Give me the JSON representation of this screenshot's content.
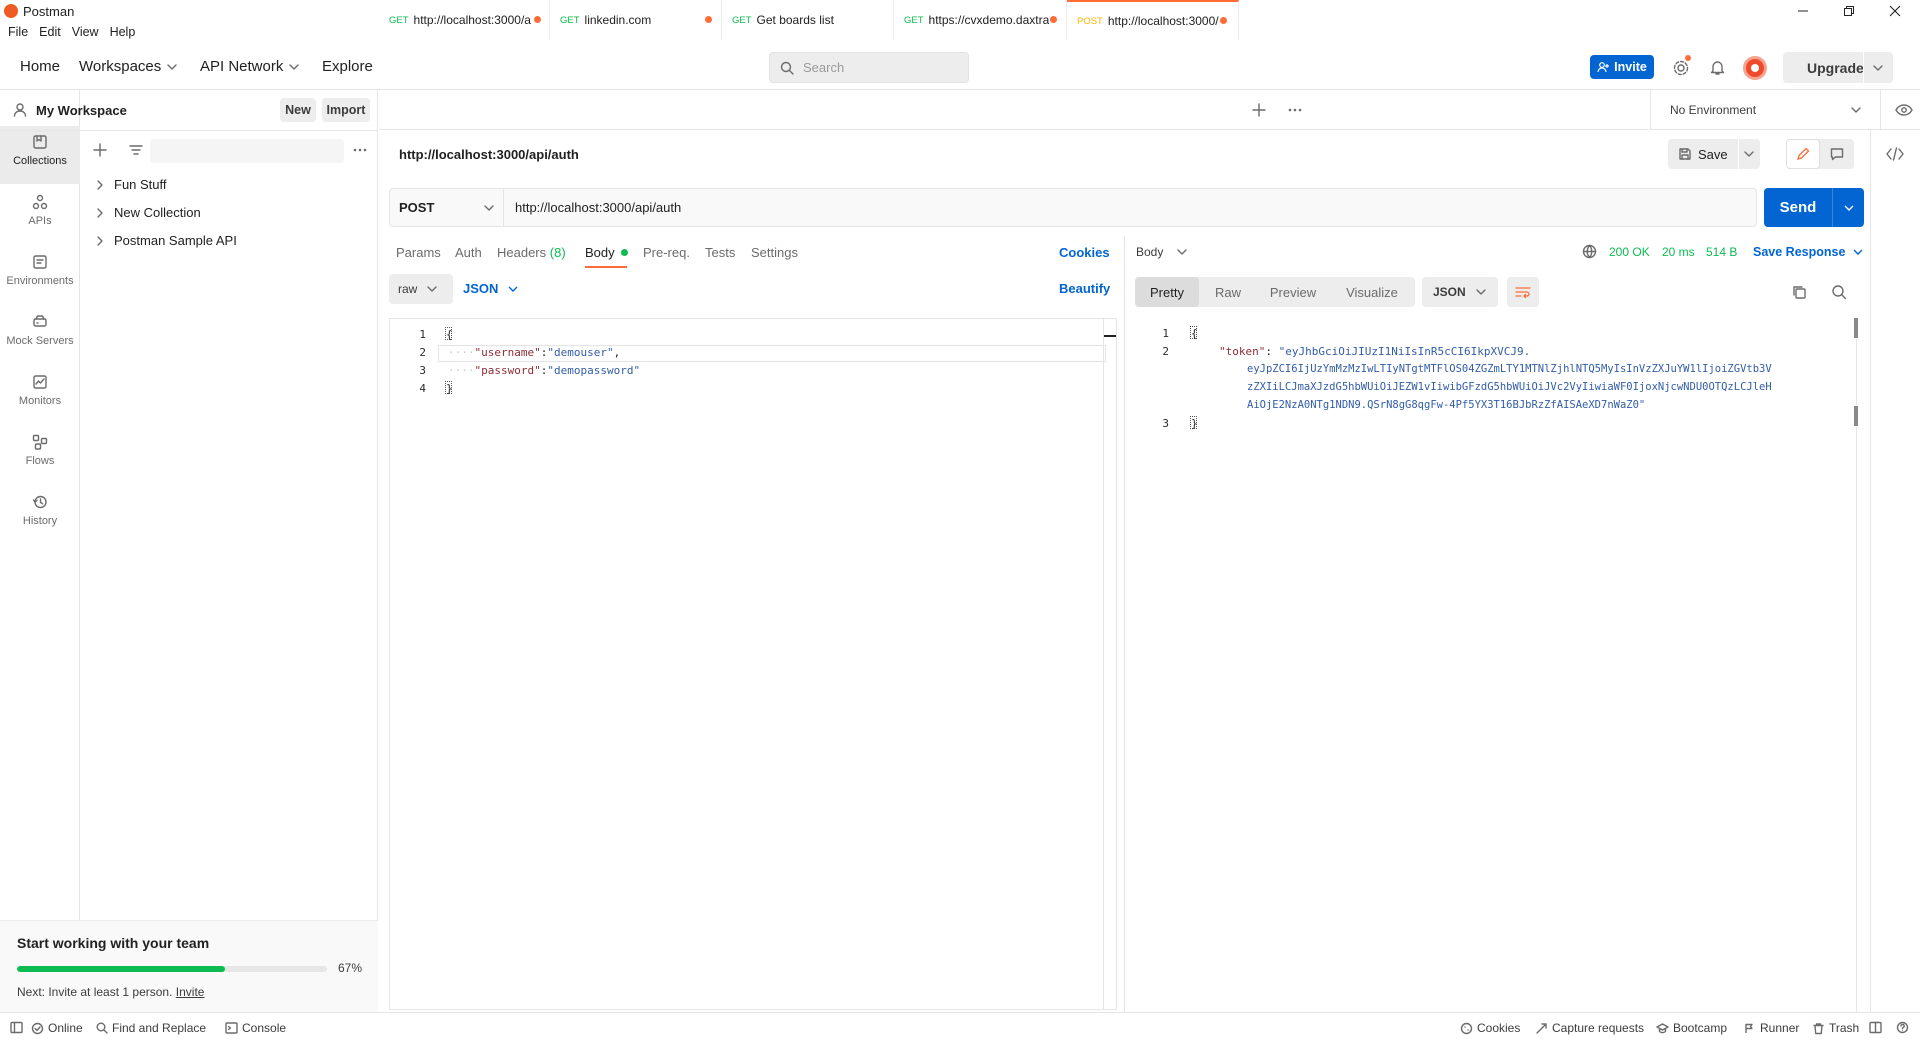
{
  "app": {
    "title": "Postman"
  },
  "menu": [
    "File",
    "Edit",
    "View",
    "Help"
  ],
  "nav": {
    "home": "Home",
    "workspaces": "Workspaces",
    "api_network": "API Network",
    "explore": "Explore"
  },
  "search": {
    "placeholder": "Search"
  },
  "header": {
    "invite": "Invite",
    "upgrade": "Upgrade"
  },
  "rail": [
    "Collections",
    "APIs",
    "Environments",
    "Mock Servers",
    "Monitors",
    "Flows",
    "History"
  ],
  "sidebar": {
    "workspace": "My Workspace",
    "new_label": "New",
    "import_label": "Import",
    "collections": [
      "Fun Stuff",
      "New Collection",
      "Postman Sample API"
    ],
    "team": {
      "title": "Start working with your team",
      "progress": 67,
      "progress_label": "67%",
      "next_text": "Next: Invite at least 1 person.",
      "next_link": "Invite"
    }
  },
  "tabs": [
    {
      "method": "GET",
      "label": "http://localhost:3000/a"
    },
    {
      "method": "GET",
      "label": "linkedin.com"
    },
    {
      "method": "GET",
      "label": "Get boards list"
    },
    {
      "method": "GET",
      "label": "https://cvxdemo.daxtra"
    },
    {
      "method": "POST",
      "label": "http://localhost:3000/"
    }
  ],
  "environment": "No Environment",
  "request": {
    "name": "http://localhost:3000/api/auth",
    "save_label": "Save",
    "method": "POST",
    "url": "http://localhost:3000/api/auth",
    "send_label": "Send",
    "subtabs": {
      "params": "Params",
      "auth": "Auth",
      "headers": "Headers",
      "headers_count": "(8)",
      "body": "Body",
      "prereq": "Pre-req.",
      "tests": "Tests",
      "settings": "Settings"
    },
    "cookies": "Cookies",
    "body_mode": "raw",
    "body_lang": "JSON",
    "beautify": "Beautify",
    "lines": [
      "1",
      "2",
      "3",
      "4"
    ],
    "body": {
      "username_key": "\"username\"",
      "username_val": "\"demouser\"",
      "password_key": "\"password\"",
      "password_val": "\"demopassword\""
    }
  },
  "response": {
    "section": "Body",
    "status": "200 OK",
    "time": "20 ms",
    "size": "514 B",
    "save_label": "Save Response",
    "views": [
      "Pretty",
      "Raw",
      "Preview",
      "Visualize"
    ],
    "format": "JSON",
    "lines": [
      "1",
      "2",
      "3"
    ],
    "token_key": "\"token\"",
    "token_lines": [
      "\"eyJhbGciOiJIUzI1NiIsInR5cCI6IkpXVCJ9.",
      "eyJpZCI6IjUzYmMzMzIwLTIyNTgtMTFlOS04ZGZmLTY1MTNlZjhlNTQ5MyIsInVzZXJuYW1lIjoiZGVtb3V",
      "zZXIiLCJmaXJzdG5hbWUiOiJEZW1vIiwibGFzdG5hbWUiOiJVc2VyIiwiaWF0IjoxNjcwNDU0OTQzLCJleH",
      "AiOjE2NzA0NTg1NDN9.QSrN8gG8qgFw-4Pf5YX3T16BJbRzZfAISAeXD7nWaZ0\""
    ]
  },
  "status": {
    "online": "Online",
    "find_replace": "Find and Replace",
    "console": "Console",
    "cookies": "Cookies",
    "capture": "Capture requests",
    "bootcamp": "Bootcamp",
    "runner": "Runner",
    "trash": "Trash"
  },
  "colors": {
    "accent": "#ff6c37",
    "primary": "#0265d2",
    "success": "#0cbb52"
  }
}
